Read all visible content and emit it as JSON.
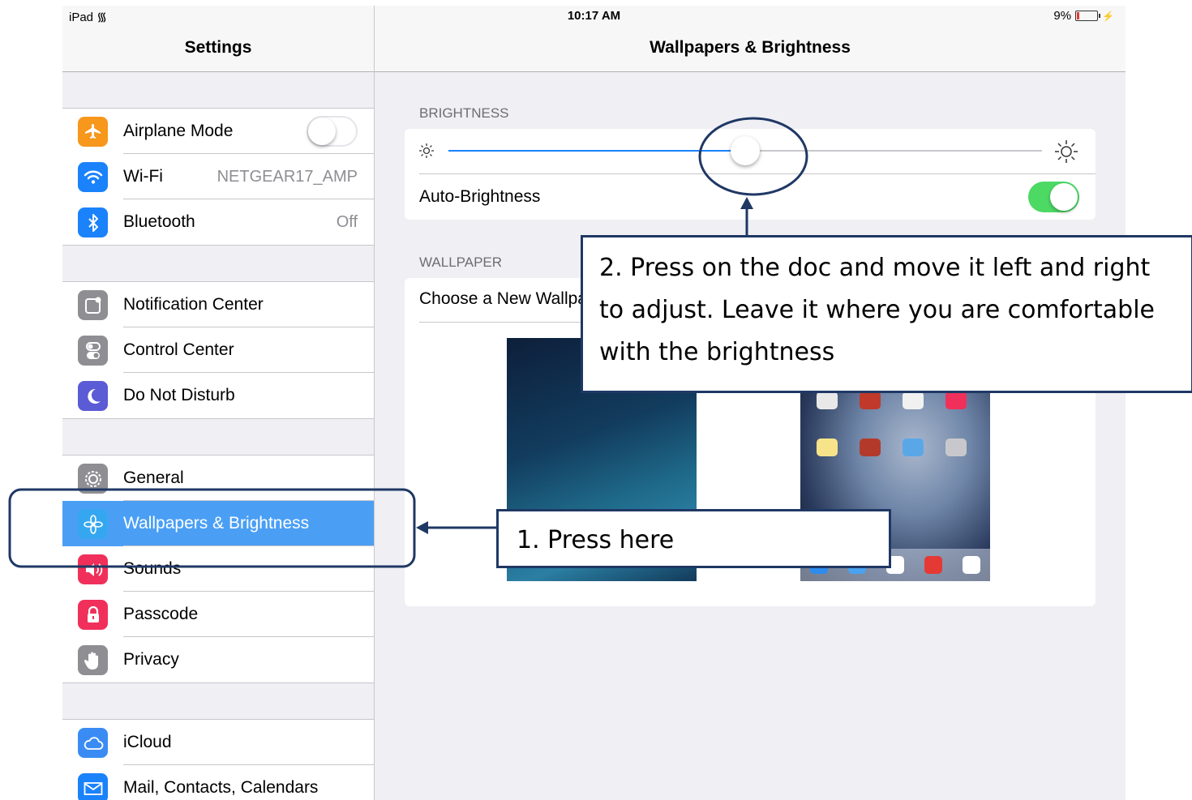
{
  "status_bar": {
    "carrier": "iPad",
    "time": "10:17 AM",
    "battery_percent": "9%"
  },
  "master": {
    "title": "Settings",
    "group1": [
      {
        "label": "Airplane Mode",
        "icon": "airplane-icon",
        "color": "#f7971c",
        "toggle": "off"
      },
      {
        "label": "Wi-Fi",
        "value": "NETGEAR17_AMP",
        "icon": "wifi-icon",
        "color": "#1a82fb"
      },
      {
        "label": "Bluetooth",
        "value": "Off",
        "icon": "bluetooth-icon",
        "color": "#1a82fb"
      }
    ],
    "group2": [
      {
        "label": "Notification Center",
        "icon": "notification-center-icon",
        "color": "#8e8e93"
      },
      {
        "label": "Control Center",
        "icon": "control-center-icon",
        "color": "#8e8e93"
      },
      {
        "label": "Do Not Disturb",
        "icon": "moon-icon",
        "color": "#5b5bd6"
      }
    ],
    "group3": [
      {
        "label": "General",
        "icon": "gear-icon",
        "color": "#8e8e93"
      },
      {
        "label": "Wallpapers & Brightness",
        "icon": "flower-icon",
        "color": "#35a7f0",
        "selected": true
      },
      {
        "label": "Sounds",
        "icon": "speaker-icon",
        "color": "#f0305a"
      },
      {
        "label": "Passcode",
        "icon": "lock-icon",
        "color": "#f0305a"
      },
      {
        "label": "Privacy",
        "icon": "hand-icon",
        "color": "#8e8e93"
      }
    ],
    "group4": [
      {
        "label": "iCloud",
        "icon": "cloud-icon",
        "color": "#3a8cf4"
      },
      {
        "label": "Mail, Contacts, Calendars",
        "icon": "mail-icon",
        "color": "#1a82fb"
      }
    ]
  },
  "detail": {
    "title": "Wallpapers & Brightness",
    "brightness_header": "BRIGHTNESS",
    "brightness_level": 0.5,
    "auto_brightness_label": "Auto-Brightness",
    "auto_brightness": "on",
    "wallpaper_header": "WALLPAPER",
    "choose_label": "Choose a New Wallpaper"
  },
  "annotations": {
    "step1": "1. Press here",
    "step2_line1": "2. Press on the doc and move it left and right",
    "step2_line2": "to adjust.  Leave it where you are comfortable",
    "step2_line3": "with the brightness",
    "color": "#1f3864"
  }
}
